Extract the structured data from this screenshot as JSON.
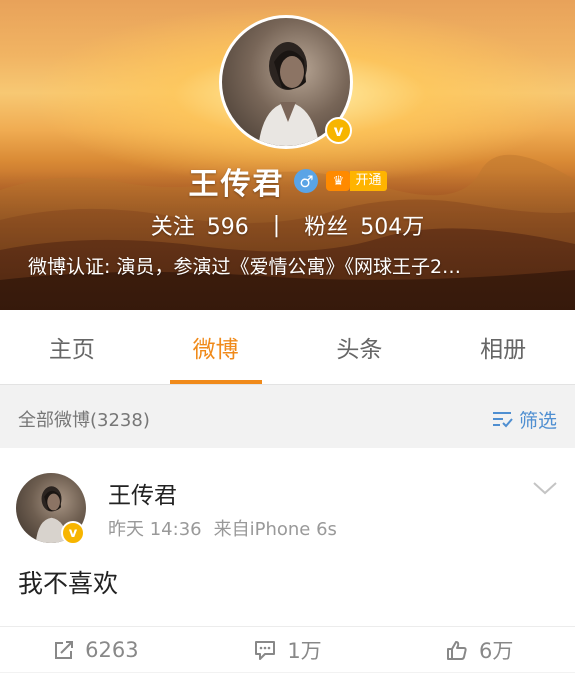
{
  "profile": {
    "name": "王传君",
    "vip_label": "开通",
    "verified_mark": "v",
    "follow_label": "关注",
    "follow_count": "596",
    "separator": "|",
    "fans_label": "粉丝",
    "fans_count": "504万",
    "certification": "微博认证: 演员，参演过《爱情公寓》《网球王子2…"
  },
  "tabs": [
    {
      "label": "主页",
      "active": false
    },
    {
      "label": "微博",
      "active": true
    },
    {
      "label": "头条",
      "active": false
    },
    {
      "label": "相册",
      "active": false
    }
  ],
  "filter": {
    "all_label": "全部微博(3238)",
    "filter_label": "筛选"
  },
  "post": {
    "author": "王传君",
    "time": "昨天 14:36",
    "source": "来自iPhone 6s",
    "text": "我不喜欢",
    "reposts": "6263",
    "comments": "1万",
    "likes": "6万"
  },
  "colors": {
    "accent": "#f08a1a",
    "link_blue": "#4f8fd1",
    "verified_gold": "#f7b500",
    "male_blue": "#5aa4e6"
  },
  "icons": {
    "gender": "male-icon",
    "repost": "repost-icon",
    "comment": "comment-icon",
    "like": "thumbs-up-icon",
    "filter": "filter-icon",
    "menu": "chevron-down-icon"
  }
}
